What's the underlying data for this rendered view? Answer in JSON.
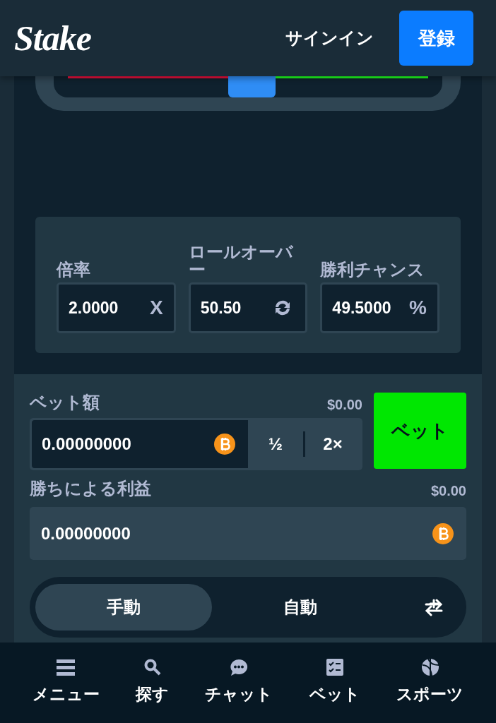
{
  "header": {
    "logo": "Stake",
    "sign_in": "サインイン",
    "register": "登録"
  },
  "slider": {
    "level": 0.51
  },
  "stats": [
    {
      "kind": "text",
      "label": "倍率",
      "value": "2.0000",
      "suffix": "X"
    },
    {
      "kind": "refresh",
      "label": "ロールオーバー",
      "value": "50.50"
    },
    {
      "kind": "text",
      "label": "勝利チャンス",
      "value": "49.5000",
      "suffix": "%"
    }
  ],
  "bet": {
    "label": "ベット額",
    "usd": "$0.00",
    "value": "0.00000000",
    "half": "½",
    "double": "2×",
    "button": "ベット"
  },
  "profit": {
    "label": "勝ちによる利益",
    "usd": "$0.00",
    "value": "0.00000000"
  },
  "mode_tabs": [
    {
      "label": "手動",
      "selected": true
    },
    {
      "label": "自動",
      "selected": false
    }
  ],
  "bottom_nav": [
    {
      "kind": "menu",
      "label": "メニュー"
    },
    {
      "kind": "search",
      "label": "探す"
    },
    {
      "kind": "chat",
      "label": "チャット"
    },
    {
      "kind": "bets",
      "label": "ベット"
    },
    {
      "kind": "sports",
      "label": "スポーツ"
    }
  ]
}
